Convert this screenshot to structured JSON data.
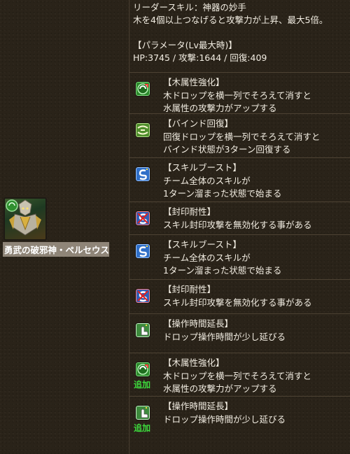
{
  "monster": {
    "name": "勇武の破邪神・ペルセウス",
    "attribute": "wood"
  },
  "leader_skill": {
    "line1": "リーダースキル：神器の妙手",
    "line2": "木を4個以上つなげると攻撃力が上昇、最大5倍。"
  },
  "params": {
    "title": "【パラメータ(Lv最大時)】",
    "stats": "HP:3745 / 攻撃:1644 / 回復:409"
  },
  "awakenings": [
    {
      "icon": "wood-enhance-icon",
      "title": "【木属性強化】",
      "lines": [
        "木ドロップを横一列でそろえて消すと",
        "水属性の攻撃力がアップする"
      ],
      "extra": ""
    },
    {
      "icon": "bind-recovery-icon",
      "title": "【バインド回復】",
      "lines": [
        "回復ドロップを横一列でそろえて消すと",
        "バインド状態が3ターン回復する"
      ],
      "extra": ""
    },
    {
      "icon": "skill-boost-icon",
      "title": "【スキルブースト】",
      "lines": [
        "チーム全体のスキルが",
        "1ターン溜まった状態で始まる"
      ],
      "extra": ""
    },
    {
      "icon": "skill-lock-resist-icon",
      "title": "【封印耐性】",
      "lines": [
        "スキル封印攻撃を無効化する事がある"
      ],
      "extra": ""
    },
    {
      "icon": "skill-boost-icon",
      "title": "【スキルブースト】",
      "lines": [
        "チーム全体のスキルが",
        "1ターン溜まった状態で始まる"
      ],
      "extra": ""
    },
    {
      "icon": "skill-lock-resist-icon",
      "title": "【封印耐性】",
      "lines": [
        "スキル封印攻撃を無効化する事がある"
      ],
      "extra": ""
    },
    {
      "icon": "time-extend-icon",
      "title": "【操作時間延長】",
      "lines": [
        "ドロップ操作時間が少し延びる"
      ],
      "extra": ""
    },
    {
      "icon": "wood-enhance-icon",
      "title": "【木属性強化】",
      "lines": [
        "木ドロップを横一列でそろえて消すと",
        "水属性の攻撃力がアップする"
      ],
      "extra": "追加"
    },
    {
      "icon": "time-extend-icon",
      "title": "【操作時間延長】",
      "lines": [
        "ドロップ操作時間が少し延びる"
      ],
      "extra": "追加"
    }
  ],
  "colors": {
    "accent_green": "#3ddc3d",
    "background": "#2a2319",
    "name_bg": "#8f8578"
  }
}
